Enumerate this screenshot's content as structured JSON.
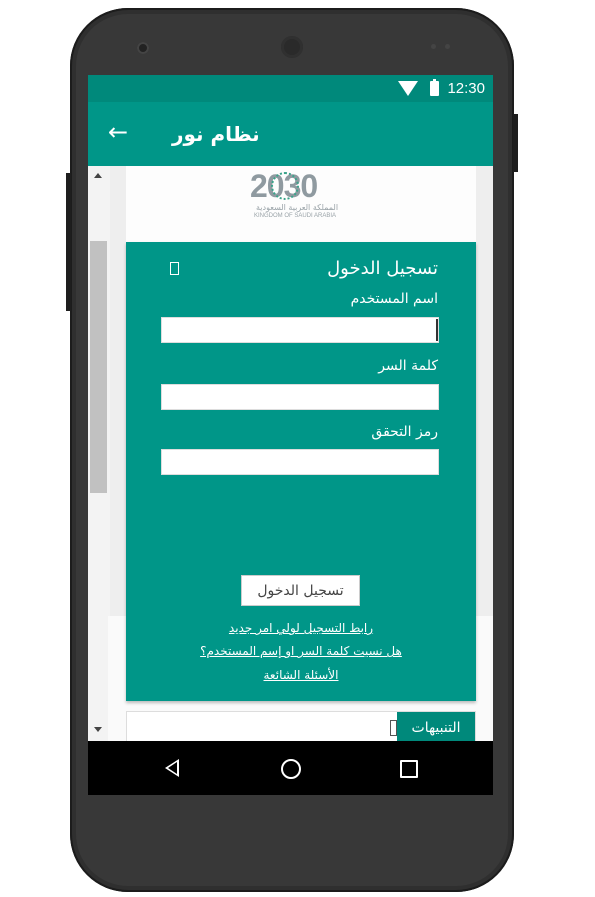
{
  "status_bar": {
    "time": "12:30",
    "icons": [
      "wifi-icon",
      "battery-icon"
    ]
  },
  "app_bar": {
    "title": "نظام نور",
    "back_icon": "←"
  },
  "logo": {
    "number": "2030",
    "arabic_text": "المملكة العربية السعودية",
    "english_text": "KINGDOM OF SAUDI ARABIA"
  },
  "login_form": {
    "heading": "تسجيل الدخول",
    "username_label": "اسم المستخدم",
    "username_value": "",
    "password_label": "كلمة السر",
    "password_value": "",
    "captcha_label": "رمز التحقق",
    "captcha_value": "",
    "submit_label": "تسجيل الدخول"
  },
  "links": {
    "register_guardian": "رابط التسجيل لولي امر جديد",
    "forgot_credentials": "هل نسيت كلمة السر او إسم المستخدم؟",
    "faq": "الأسئلة الشائعة"
  },
  "alerts": {
    "tab_label": "التنبيهات"
  },
  "colors": {
    "primary": "#009688",
    "primary_dark": "#00897b",
    "frame": "#2f2f2f"
  },
  "nav_icons": [
    "back-triangle-icon",
    "home-circle-icon",
    "recents-square-icon"
  ]
}
